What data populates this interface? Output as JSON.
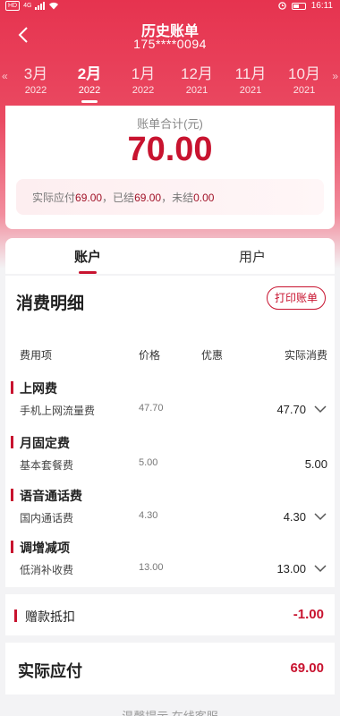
{
  "status": {
    "time": "16:11",
    "net_type": "HD",
    "net_gen": "4G"
  },
  "header": {
    "title": "历史账单",
    "phone": "175****0094"
  },
  "months": [
    {
      "month": "3月",
      "year": "2022"
    },
    {
      "month": "2月",
      "year": "2022",
      "active": true
    },
    {
      "month": "1月",
      "year": "2022"
    },
    {
      "month": "12月",
      "year": "2021"
    },
    {
      "month": "11月",
      "year": "2021"
    },
    {
      "month": "10月",
      "year": "2021"
    }
  ],
  "summary": {
    "label": "账单合计(元)",
    "total": "70.00",
    "payable_label": "实际应付",
    "payable": "69.00",
    "settled_label": "，已结",
    "settled": "69.00",
    "unsettled_label": "，未结",
    "unsettled": "0.00"
  },
  "tabs": [
    {
      "label": "账户",
      "active": true
    },
    {
      "label": "用户"
    }
  ],
  "details": {
    "title": "消费明细",
    "print_button": "打印账单",
    "columns": {
      "item": "费用项",
      "price": "价格",
      "discount": "优惠",
      "actual": "实际消费"
    },
    "groups": [
      {
        "name": "上网费",
        "item": "手机上网流量费",
        "price": "47.70",
        "actual": "47.70",
        "expandable": true
      },
      {
        "name": "月固定费",
        "item": "基本套餐费",
        "price": "5.00",
        "actual": "5.00",
        "expandable": false
      },
      {
        "name": "语音通话费",
        "item": "国内通话费",
        "price": "4.30",
        "actual": "4.30",
        "expandable": true
      },
      {
        "name": "调增减项",
        "item": "低消补收费",
        "price": "13.00",
        "actual": "13.00",
        "expandable": true
      }
    ]
  },
  "gift": {
    "label": "赠款抵扣",
    "value": "-1.00"
  },
  "payable": {
    "label": "实际应付",
    "value": "69.00"
  },
  "footer_partial": "温馨提示  在线客服",
  "colors": {
    "accent": "#c8132f",
    "hero": "#e6334f"
  }
}
